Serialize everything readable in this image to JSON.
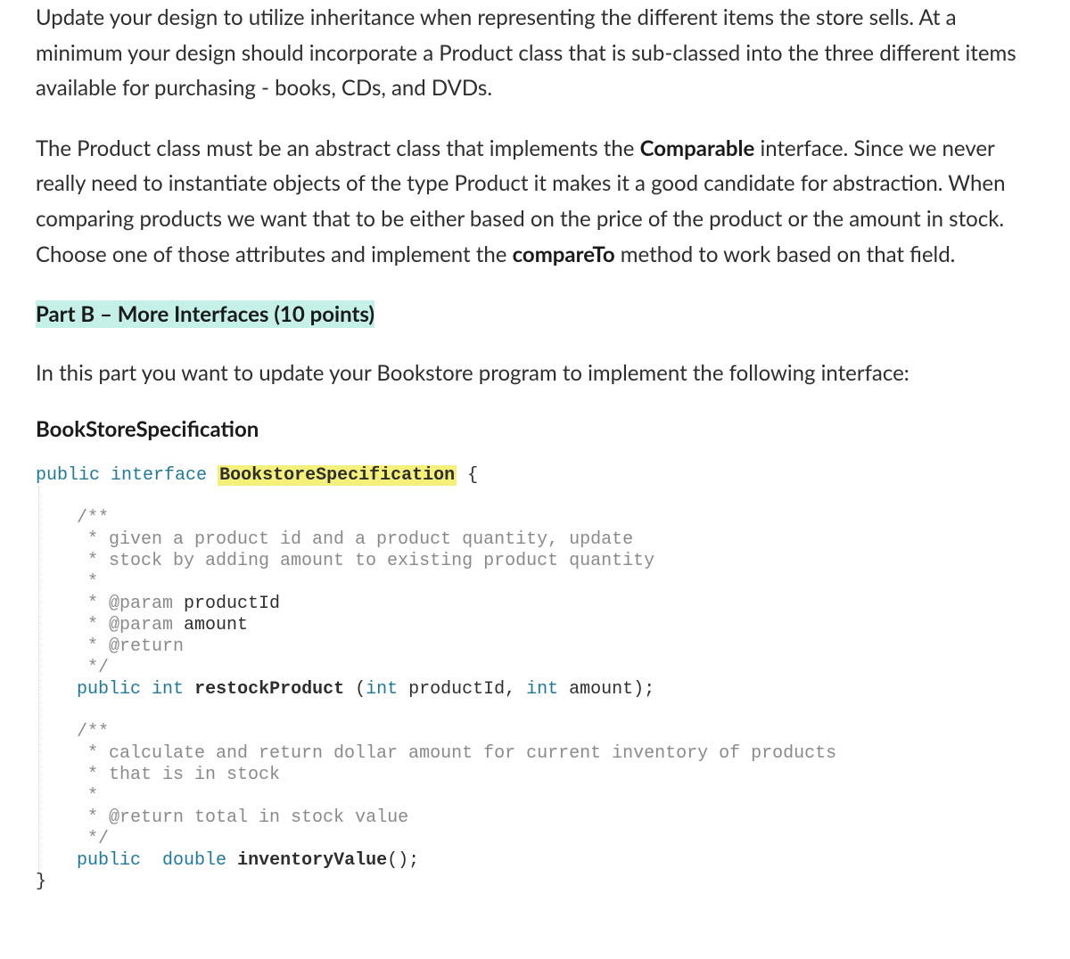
{
  "para1_pre": "Update your design to utilize inheritance when representing the different items the store sells. At a minimum your design should incorporate a Product class that is sub-classed into the three different items available for purchasing - books, CDs, and DVDs.",
  "para2_a": "The Product class must be an abstract class that implements the ",
  "para2_strong1": "Comparable",
  "para2_b": " interface. Since we never really need to instantiate objects of the type Product it makes it a good candidate for abstraction. When comparing products we want that to be either based on the price of the product or the amount in stock. Choose one of those attributes and implement the ",
  "para2_strong2": "compareTo",
  "para2_c": " method to work based on that field.",
  "section_heading": "Part B – More Interfaces (10 points)",
  "para3": "In this part you want to update your Bookstore program to implement the following interface:",
  "interface_title": "BookStoreSpecification",
  "code": {
    "kw_public": "public",
    "kw_interface": "interface",
    "type_name": "BookstoreSpecification",
    "brace_open": " {",
    "c1": "/**",
    "c2": " * given a product id and a product quantity, update",
    "c3": " * stock by adding amount to existing product quantity",
    "c4": " *",
    "c5": " * @param",
    "c5b": " productId",
    "c6": " * @param",
    "c6b": " amount",
    "c7": " * @return",
    "c8": " */",
    "m1_pub": "public",
    "m1_int": "int",
    "m1_name": "restockProduct",
    "m1_paren_open": " (",
    "m1_p1_type": "int",
    "m1_p1_name": " productId, ",
    "m1_p2_type": "int",
    "m1_p2_name": " amount);",
    "c9": "/**",
    "c10": " * calculate and return dollar amount for current inventory of products",
    "c11": " * that is in stock",
    "c12": " *",
    "c13": " * @return",
    "c13b": " total in stock value",
    "c14": " */",
    "m2_pub": "public",
    "m2_dbl": "double",
    "m2_name": "inventoryValue",
    "m2_rest": "();",
    "brace_close": "}"
  }
}
